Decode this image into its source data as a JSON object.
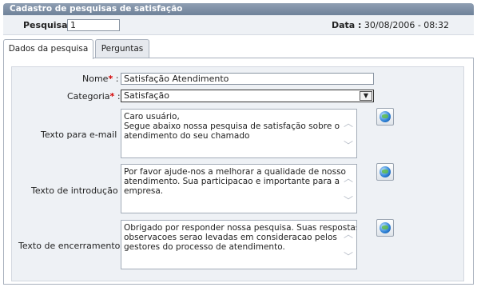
{
  "window": {
    "title": "Cadastro de pesquisas de satisfação"
  },
  "header": {
    "pesquisa_label": "Pesquisa :",
    "pesquisa_value": "1",
    "data_label": "Data :",
    "data_value": "30/08/2006 - 08:32"
  },
  "tabs": [
    {
      "label": "Dados da pesquisa",
      "active": true
    },
    {
      "label": "Perguntas",
      "active": false
    }
  ],
  "form": {
    "nome": {
      "label": "Nome",
      "required_mark": "*",
      "colon": ":",
      "value": "Satisfação Atendimento"
    },
    "categoria": {
      "label": "Categoria",
      "required_mark": "*",
      "colon": ":",
      "value": "Satisfação"
    },
    "texto_email": {
      "label": "Texto para e-mail :",
      "lines": [
        "Caro usuário,",
        "Segue abaixo nossa pesquisa de satisfação sobre o",
        "atendimento do seu chamado"
      ]
    },
    "texto_introducao": {
      "label": "Texto de introdução :",
      "lines": [
        "Por favor ajude-nos a melhorar a qualidade de nosso",
        "atendimento. Sua participacao e importante para a",
        "empresa."
      ]
    },
    "texto_encerramento": {
      "label": "Texto de encerramento :",
      "lines": [
        "Obrigado por responder nossa pesquisa. Suas respostas e",
        "observacoes serao levadas em consideracao pelos",
        "gestores do processo de atendimento."
      ]
    }
  },
  "icons": {
    "globe": "globe-icon",
    "dropdown": "chevron-down-icon",
    "scroll_up": "chevron-up-icon",
    "scroll_down": "chevron-down-icon"
  }
}
